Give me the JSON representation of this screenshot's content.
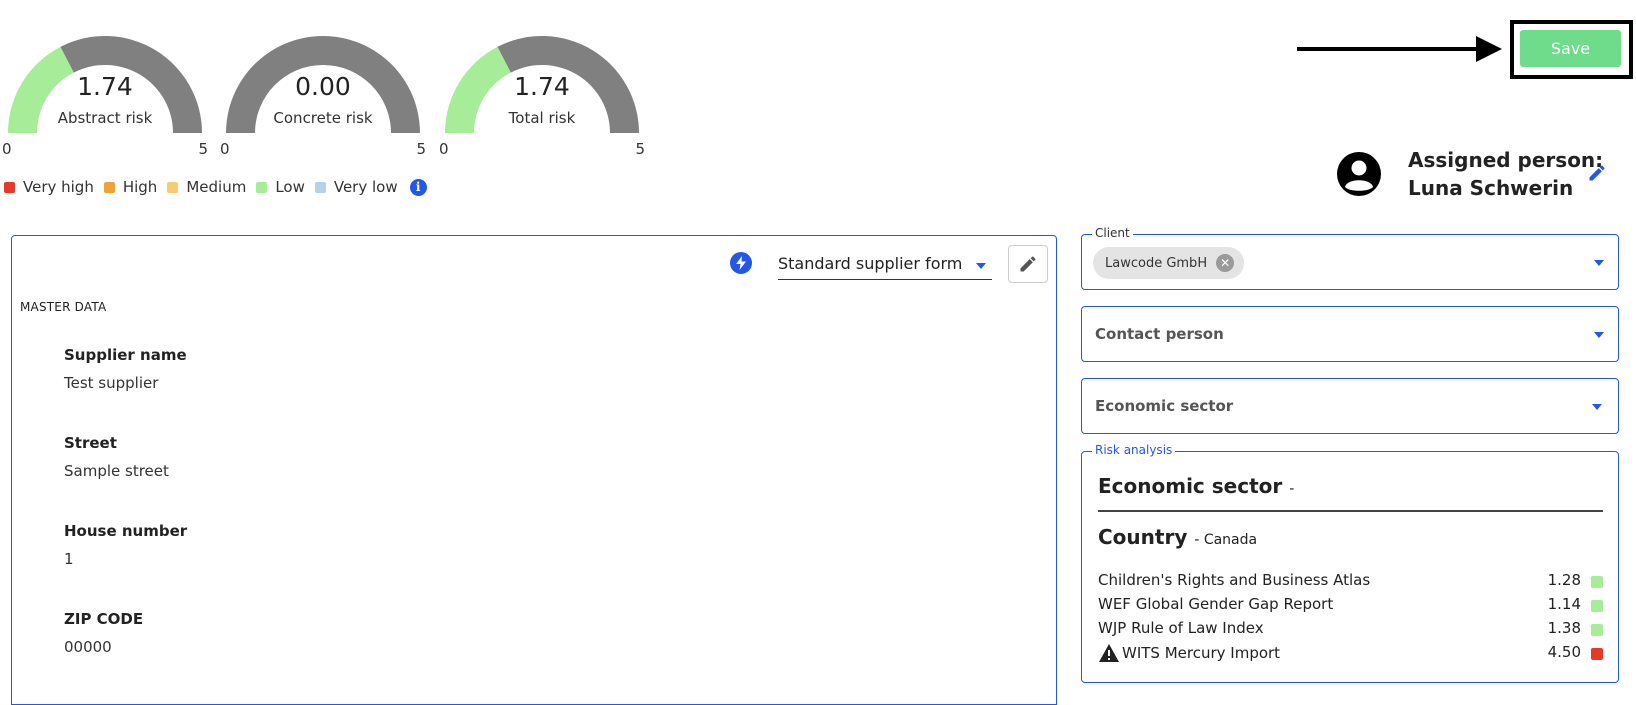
{
  "gauges": [
    {
      "value": "1.74",
      "label": "Abstract risk",
      "min": "0",
      "max": "5",
      "level": 0.348,
      "fill_color": "#a6ec99",
      "track_color": "#808080"
    },
    {
      "value": "0.00",
      "label": "Concrete risk",
      "min": "0",
      "max": "5",
      "level": 0.0,
      "fill_color": "#a6ec99",
      "track_color": "#808080"
    },
    {
      "value": "1.74",
      "label": "Total risk",
      "min": "0",
      "max": "5",
      "level": 0.348,
      "fill_color": "#a6ec99",
      "track_color": "#808080"
    }
  ],
  "legend": [
    {
      "label": "Very high",
      "color": "#e53a2a"
    },
    {
      "label": "High",
      "color": "#f0a23a"
    },
    {
      "label": "Medium",
      "color": "#f3cd76"
    },
    {
      "label": "Low",
      "color": "#a6ec99"
    },
    {
      "label": "Very low",
      "color": "#b5d3e8"
    }
  ],
  "legend_info_icon": "info-icon",
  "save": {
    "label": "Save",
    "color": "#6edc8a"
  },
  "assigned": {
    "label": "Assigned person:",
    "name": "Luna Schwerin",
    "edit_icon": "pencil-icon"
  },
  "form": {
    "selected_form": "Standard supplier form",
    "section": "MASTER DATA",
    "fields": [
      {
        "label": "Supplier name",
        "value": "Test supplier"
      },
      {
        "label": "Street",
        "value": "Sample street"
      },
      {
        "label": "House number",
        "value": "1"
      },
      {
        "label": "ZIP CODE",
        "value": "00000"
      }
    ]
  },
  "client": {
    "label": "Client",
    "chip": "Lawcode GmbH"
  },
  "contact_person": {
    "placeholder": "Contact person"
  },
  "economic_sector": {
    "placeholder": "Economic sector"
  },
  "risk_analysis": {
    "label": "Risk analysis",
    "sector_title": "Economic sector",
    "sector_value": "-",
    "country_title": "Country",
    "country_value": "- Canada",
    "indicators": [
      {
        "name": "Children's Rights and Business Atlas",
        "value": "1.28",
        "color": "#a6ec99",
        "warning": false
      },
      {
        "name": "WEF Global Gender Gap Report",
        "value": "1.14",
        "color": "#a6ec99",
        "warning": false
      },
      {
        "name": "WJP Rule of Law Index",
        "value": "1.38",
        "color": "#a6ec99",
        "warning": false
      },
      {
        "name": "WITS Mercury Import",
        "value": "4.50",
        "color": "#e53a2a",
        "warning": true
      }
    ]
  },
  "accent_color": "#2257e8"
}
